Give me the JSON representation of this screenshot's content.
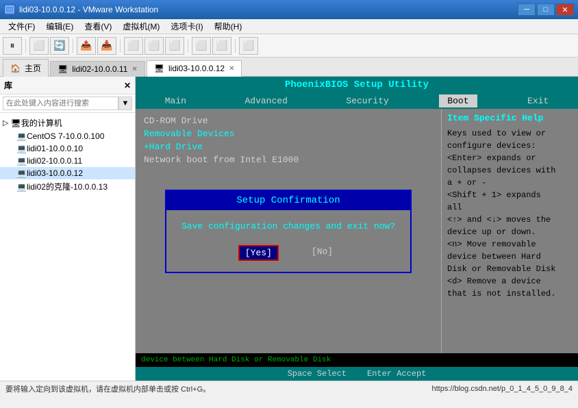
{
  "titleBar": {
    "icon": "VM",
    "title": "lidi03-10.0.0.12 - VMware Workstation",
    "minimize": "─",
    "maximize": "□",
    "close": "✕"
  },
  "menuBar": {
    "items": [
      "文件(F)",
      "编辑(E)",
      "查看(V)",
      "虚拟机(M)",
      "选项卡(I)",
      "帮助(H)"
    ]
  },
  "tabs": [
    {
      "id": "home",
      "label": "主页",
      "icon": "🏠",
      "closable": false
    },
    {
      "id": "vm1",
      "label": "lidi02-10.0.0.11",
      "closable": true
    },
    {
      "id": "vm2",
      "label": "lidi03-10.0.0.12",
      "closable": true,
      "active": true
    }
  ],
  "sidebar": {
    "header": "库",
    "searchPlaceholder": "在此处键入内容进行搜索",
    "tree": [
      {
        "id": "my-pc",
        "label": "我的计算机",
        "indent": 0,
        "hasChildren": true,
        "icon": "🖥"
      },
      {
        "id": "centos",
        "label": "CentOS 7-10.0.0.100",
        "indent": 1,
        "icon": "💻"
      },
      {
        "id": "lidi01",
        "label": "lidi01-10.0.0.10",
        "indent": 1,
        "icon": "💻"
      },
      {
        "id": "lidi02",
        "label": "lidi02-10.0.0.11",
        "indent": 1,
        "icon": "💻"
      },
      {
        "id": "lidi03",
        "label": "lidi03-10.0.0.12",
        "indent": 1,
        "icon": "💻",
        "selected": true
      },
      {
        "id": "lidi02ke",
        "label": "lidi02的克隆-10.0.0.13",
        "indent": 1,
        "icon": "💻"
      }
    ]
  },
  "bios": {
    "title": "PhoenixBIOS Setup Utility",
    "navItems": [
      {
        "label": "Main",
        "active": false
      },
      {
        "label": "Advanced",
        "active": false
      },
      {
        "label": "Security",
        "active": false
      },
      {
        "label": "Boot",
        "active": true
      },
      {
        "label": "Exit",
        "active": false
      }
    ],
    "bootItems": [
      {
        "label": "CD-ROM Drive",
        "type": "normal"
      },
      {
        "label": "Removable Devices",
        "type": "highlight"
      },
      {
        "label": "+Hard Drive",
        "type": "highlight"
      },
      {
        "label": "Network boot from Intel E1000",
        "type": "normal"
      }
    ],
    "helpTitle": "Item Specific Help",
    "helpText": "Keys used to view or configure devices: <Enter> expands or collapses devices with a + or - <Shift + 1> expands all <↑> and <↓> moves the device up or down. <n> Move removable device between Hard Disk or Removable Disk <d> Remove a device that is not installed.",
    "statusBar": [
      "Space  Select",
      "Enter  Accept"
    ]
  },
  "modal": {
    "title": "Setup Confirmation",
    "question": "Save configuration changes and exit now?",
    "buttons": [
      {
        "label": "[Yes]",
        "active": true
      },
      {
        "label": "[No]",
        "active": false
      }
    ]
  },
  "statusBar": {
    "left": "要将输入定向到该虚拟机，请在虚拟机内部单击或按 Ctrl+G。",
    "right": "https://blog.csdn.net/p_0_1_4_5_0_9_8_4"
  }
}
